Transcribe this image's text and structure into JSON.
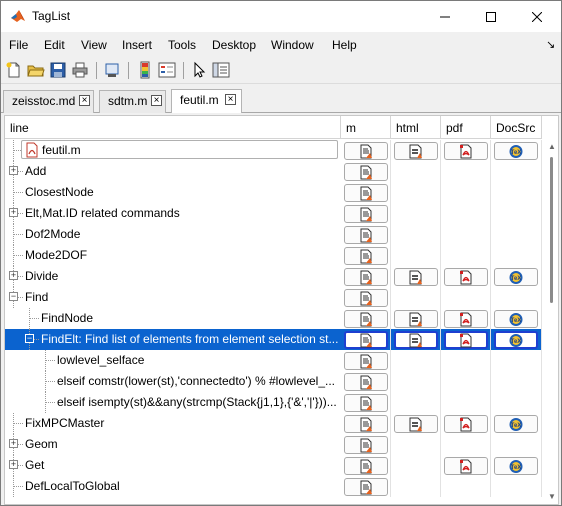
{
  "window": {
    "title": "TagList"
  },
  "menu": [
    "File",
    "Edit",
    "View",
    "Insert",
    "Tools",
    "Desktop",
    "Window",
    "Help"
  ],
  "tabs": [
    {
      "label": "zeisstoc.md",
      "active": false
    },
    {
      "label": "sdtm.m",
      "active": false
    },
    {
      "label": "feutil.m",
      "active": true
    }
  ],
  "columns": [
    "line",
    "m",
    "html",
    "pdf",
    "DocSrc"
  ],
  "rows": [
    {
      "label": "feutil.m",
      "kind": "file",
      "m": true,
      "html": true,
      "pdf": true,
      "doc": true
    },
    {
      "label": "Add",
      "expander": "+",
      "m": true,
      "html": false,
      "pdf": false,
      "doc": false
    },
    {
      "label": "ClosestNode",
      "m": true,
      "html": false,
      "pdf": false,
      "doc": false
    },
    {
      "label": "Elt,Mat.ID related commands",
      "expander": "+",
      "m": true,
      "html": false,
      "pdf": false,
      "doc": false
    },
    {
      "label": "Dof2Mode",
      "m": true,
      "html": false,
      "pdf": false,
      "doc": false
    },
    {
      "label": "Mode2DOF",
      "m": true,
      "html": false,
      "pdf": false,
      "doc": false
    },
    {
      "label": "Divide",
      "expander": "+",
      "m": true,
      "html": true,
      "pdf": true,
      "doc": true
    },
    {
      "label": "Find",
      "expander": "−",
      "m": true,
      "html": false,
      "pdf": false,
      "doc": false
    },
    {
      "label": "FindNode",
      "m": true,
      "html": true,
      "pdf": true,
      "doc": true
    },
    {
      "label": "FindElt:  Find list of elements from element selection st...",
      "expander": "−",
      "selected": true,
      "m": true,
      "html": true,
      "pdf": true,
      "doc": true
    },
    {
      "label": "lowlevel_selface",
      "m": true,
      "html": false,
      "pdf": false,
      "doc": false
    },
    {
      "label": "elseif comstr(lower(st),'connectedto') % #lowlevel_...",
      "m": true,
      "html": false,
      "pdf": false,
      "doc": false
    },
    {
      "label": "elseif isempty(st)&&any(strcmp(Stack{j1,1},{'&','|'}))...",
      "m": true,
      "html": false,
      "pdf": false,
      "doc": false
    },
    {
      "label": "FixMPCMaster",
      "m": true,
      "html": true,
      "pdf": true,
      "doc": true
    },
    {
      "label": "Geom",
      "expander": "+",
      "m": true,
      "html": false,
      "pdf": false,
      "doc": false
    },
    {
      "label": "Get",
      "expander": "+",
      "m": true,
      "html": false,
      "pdf": true,
      "doc": true
    },
    {
      "label": "DefLocalToGlobal",
      "m": true,
      "html": false,
      "pdf": false,
      "doc": false
    }
  ],
  "icons": {
    "app": "matlab-logo-icon",
    "m_cell": "m-file-icon",
    "html_cell": "html-page-icon",
    "pdf_cell": "pdf-file-icon",
    "doc_cell": "tex-icon"
  },
  "colors": {
    "selection": "#0b63cf",
    "selection_border": "#1e3fd0"
  }
}
